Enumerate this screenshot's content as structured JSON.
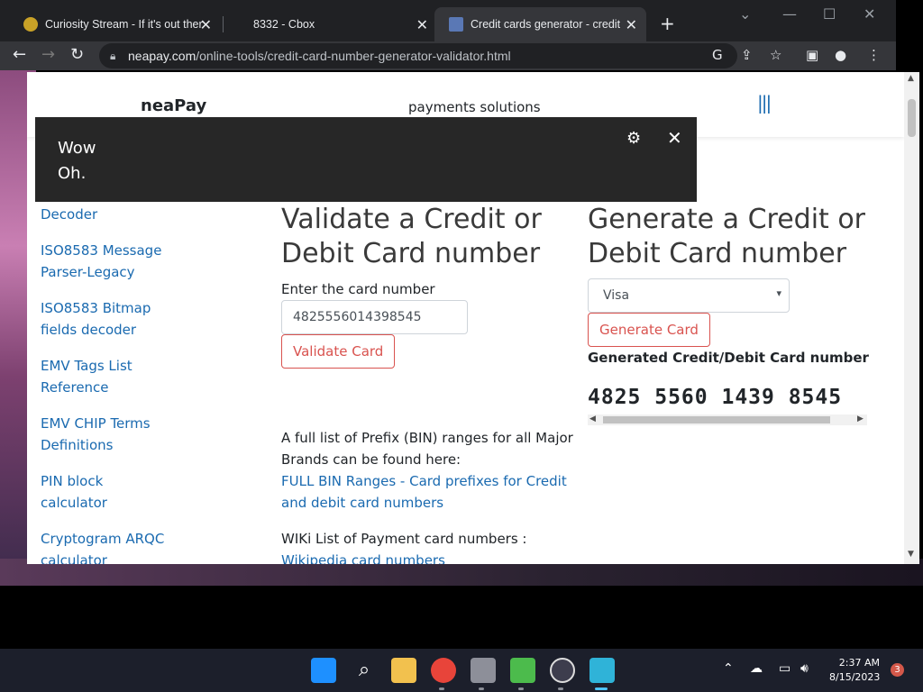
{
  "browser": {
    "tabs": [
      {
        "label": "Curiosity Stream - If it's out there",
        "icon": "lightbulb-icon"
      },
      {
        "label": "8332 - Cbox",
        "icon": ""
      },
      {
        "label": "Credit cards generator - credit c",
        "icon": "neapay-icon"
      }
    ],
    "url_host": "neapay.com",
    "url_path": "/online-tools/credit-card-number-generator-validator.html"
  },
  "site": {
    "brand": "neaPay",
    "tagline": "payments solutions",
    "menu_icon": "|||"
  },
  "sidebar": {
    "faded_top": "Decoder",
    "items": [
      {
        "label": "Decoder"
      },
      {
        "label": "ISO8583 Message Parser-Legacy"
      },
      {
        "label": "ISO8583 Bitmap fields decoder"
      },
      {
        "label": "EMV Tags List Reference"
      },
      {
        "label": "EMV CHIP Terms Definitions"
      },
      {
        "label": "PIN block calculator"
      },
      {
        "label": "Cryptogram ARQC calculator"
      }
    ]
  },
  "validate": {
    "heading_line1": "Validate a Credit or",
    "heading_line2": "Debit Card number",
    "input_label": "Enter the card number",
    "input_value": "4825556014398545",
    "button": "Validate Card",
    "bin_text_1": "A full list of Prefix (BIN) ranges for all Major",
    "bin_text_2": "Brands can be found here:",
    "bin_link_1": "FULL BIN Ranges - Card prefixes for Credit",
    "bin_link_2": "and debit card numbers",
    "wiki_text": "WIKi List of Payment card numbers :",
    "wiki_link": "Wikipedia card numbers"
  },
  "generate": {
    "heading_line1": "Generate a Credit or",
    "heading_line2": "Debit Card number",
    "select_value": "Visa",
    "button": "Generate Card",
    "result_title": "Generated Credit/Debit Card number",
    "result_number": "4825 5560 1439 8545"
  },
  "caption": {
    "line1": "Wow",
    "line2": "Oh."
  },
  "taskbar": {
    "time": "2:37 AM",
    "date": "8/15/2023",
    "notifications": "3"
  }
}
